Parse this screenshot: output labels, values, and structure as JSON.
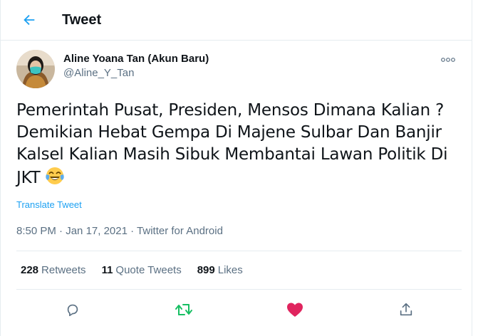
{
  "header": {
    "title": "Tweet"
  },
  "author": {
    "display_name": "Aline Yoana Tan (Akun Baru)",
    "handle": "@Aline_Y_Tan"
  },
  "tweet": {
    "text": "Pemerintah Pusat, Presiden, Mensos Dimana Kalian ? Demikian Hebat Gempa Di Majene Sulbar Dan Banjir Kalsel Kalian Masih Sibuk Membantai Lawan Politik Di JKT",
    "emoji": "face-with-tears-of-joy",
    "translate_label": "Translate Tweet",
    "time": "8:50 PM",
    "date": "Jan 17, 2021",
    "separator": "·",
    "source": "Twitter for Android"
  },
  "stats": {
    "retweets_count": "228",
    "retweets_label": "Retweets",
    "quotes_count": "11",
    "quotes_label": "Quote Tweets",
    "likes_count": "899",
    "likes_label": "Likes"
  },
  "icons": {
    "back": "arrow-left-icon",
    "more": "more-dots-icon",
    "reply": "reply-icon",
    "retweet": "retweet-icon",
    "like": "heart-icon",
    "share": "share-icon"
  },
  "colors": {
    "accent": "#1da1f2",
    "retweet": "#17bf63",
    "like": "#e0245e",
    "secondary_text": "#5b7083",
    "border": "#e6ecf0"
  }
}
